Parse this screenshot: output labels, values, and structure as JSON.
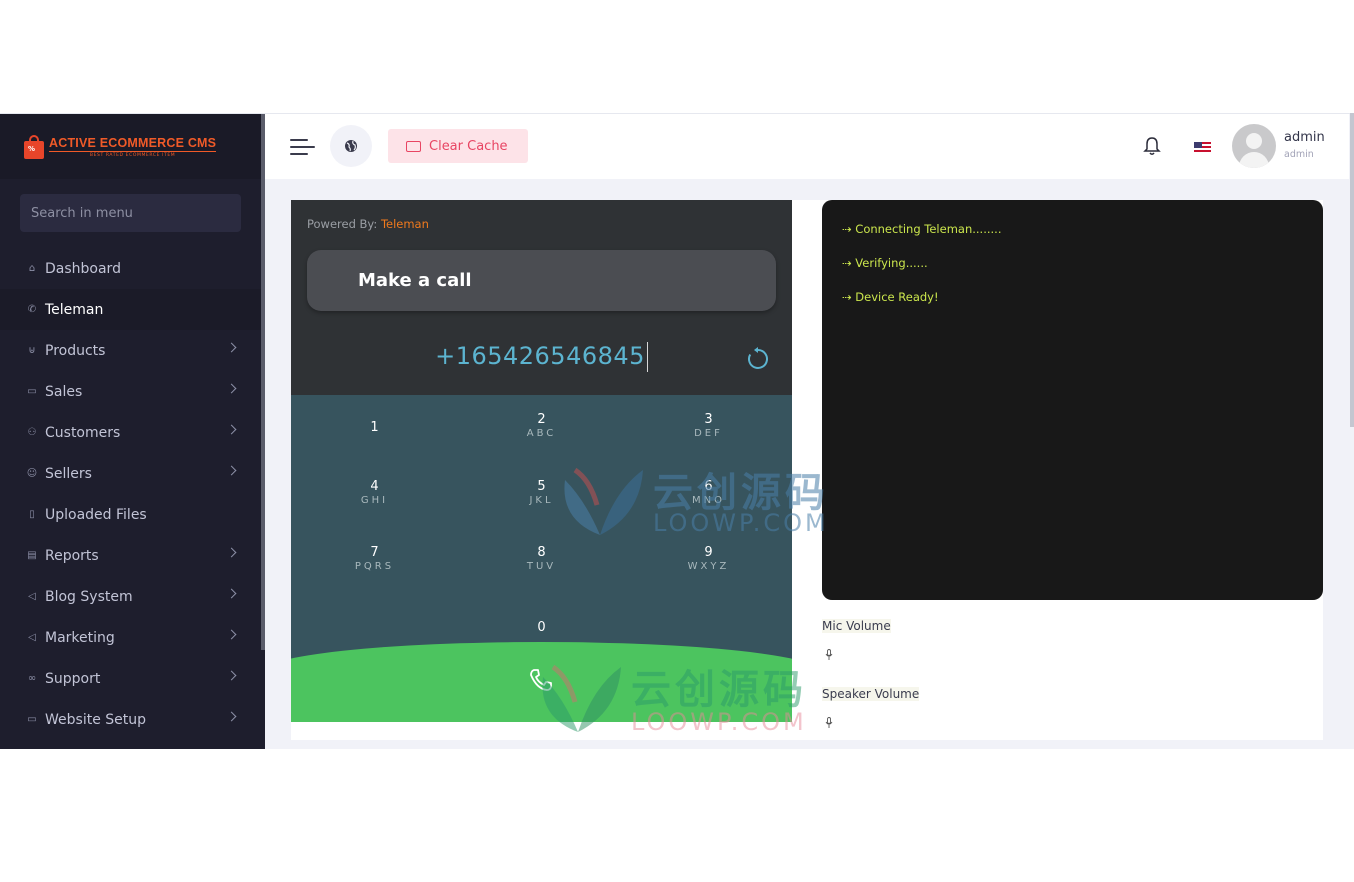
{
  "brand": {
    "name": "ACTIVE ECOMMERCE CMS",
    "tagline": "BEST RATED ECOMMERCE ITEM"
  },
  "sidebar": {
    "search_placeholder": "Search in menu",
    "items": [
      {
        "label": "Dashboard",
        "icon": "home-icon",
        "has_children": false,
        "active": false
      },
      {
        "label": "Teleman",
        "icon": "phone-icon",
        "has_children": false,
        "active": true
      },
      {
        "label": "Products",
        "icon": "cart-icon",
        "has_children": true,
        "active": false
      },
      {
        "label": "Sales",
        "icon": "money-icon",
        "has_children": true,
        "active": false
      },
      {
        "label": "Customers",
        "icon": "users-icon",
        "has_children": true,
        "active": false
      },
      {
        "label": "Sellers",
        "icon": "user-icon",
        "has_children": true,
        "active": false
      },
      {
        "label": "Uploaded Files",
        "icon": "file-icon",
        "has_children": false,
        "active": false
      },
      {
        "label": "Reports",
        "icon": "report-icon",
        "has_children": true,
        "active": false
      },
      {
        "label": "Blog System",
        "icon": "megaphone-icon",
        "has_children": true,
        "active": false
      },
      {
        "label": "Marketing",
        "icon": "bullhorn-icon",
        "has_children": true,
        "active": false
      },
      {
        "label": "Support",
        "icon": "link-icon",
        "has_children": true,
        "active": false
      },
      {
        "label": "Website Setup",
        "icon": "desktop-icon",
        "has_children": true,
        "active": false
      }
    ]
  },
  "topbar": {
    "clear_cache_label": "Clear Cache",
    "user_name": "admin",
    "user_role": "admin",
    "language_flag": "us-flag-icon"
  },
  "dialer": {
    "powered_by": "Powered By: ",
    "powered_brand": "Teleman",
    "title": "Make a call",
    "number": "+165426546845",
    "keys": [
      {
        "digit": "1",
        "letters": ""
      },
      {
        "digit": "2",
        "letters": "ABC"
      },
      {
        "digit": "3",
        "letters": "DEF"
      },
      {
        "digit": "4",
        "letters": "GHI"
      },
      {
        "digit": "5",
        "letters": "JKL"
      },
      {
        "digit": "6",
        "letters": "MNO"
      },
      {
        "digit": "7",
        "letters": "PQRS"
      },
      {
        "digit": "8",
        "letters": "TUV"
      },
      {
        "digit": "9",
        "letters": "WXYZ"
      },
      {
        "digit": "0",
        "letters": ""
      }
    ]
  },
  "console": {
    "logs": [
      "⇢ Connecting Teleman........",
      "⇢ Verifying......",
      "⇢ Device Ready!"
    ]
  },
  "volume": {
    "mic_label": "Mic Volume",
    "speaker_label": "Speaker Volume"
  },
  "watermark": {
    "cn": "云创源码",
    "en": "LOOWP.COM"
  },
  "colors": {
    "sidebar_bg": "#1e1e2d",
    "brand_orange": "#f05a28",
    "clear_cache_bg": "#fde3e8",
    "clear_cache_text": "#e84563",
    "dialer_bg": "#2f3235",
    "keypad_bg": "#37545e",
    "call_green": "#4cc45f",
    "console_bg": "#181818",
    "log_text": "#cbe64d"
  }
}
